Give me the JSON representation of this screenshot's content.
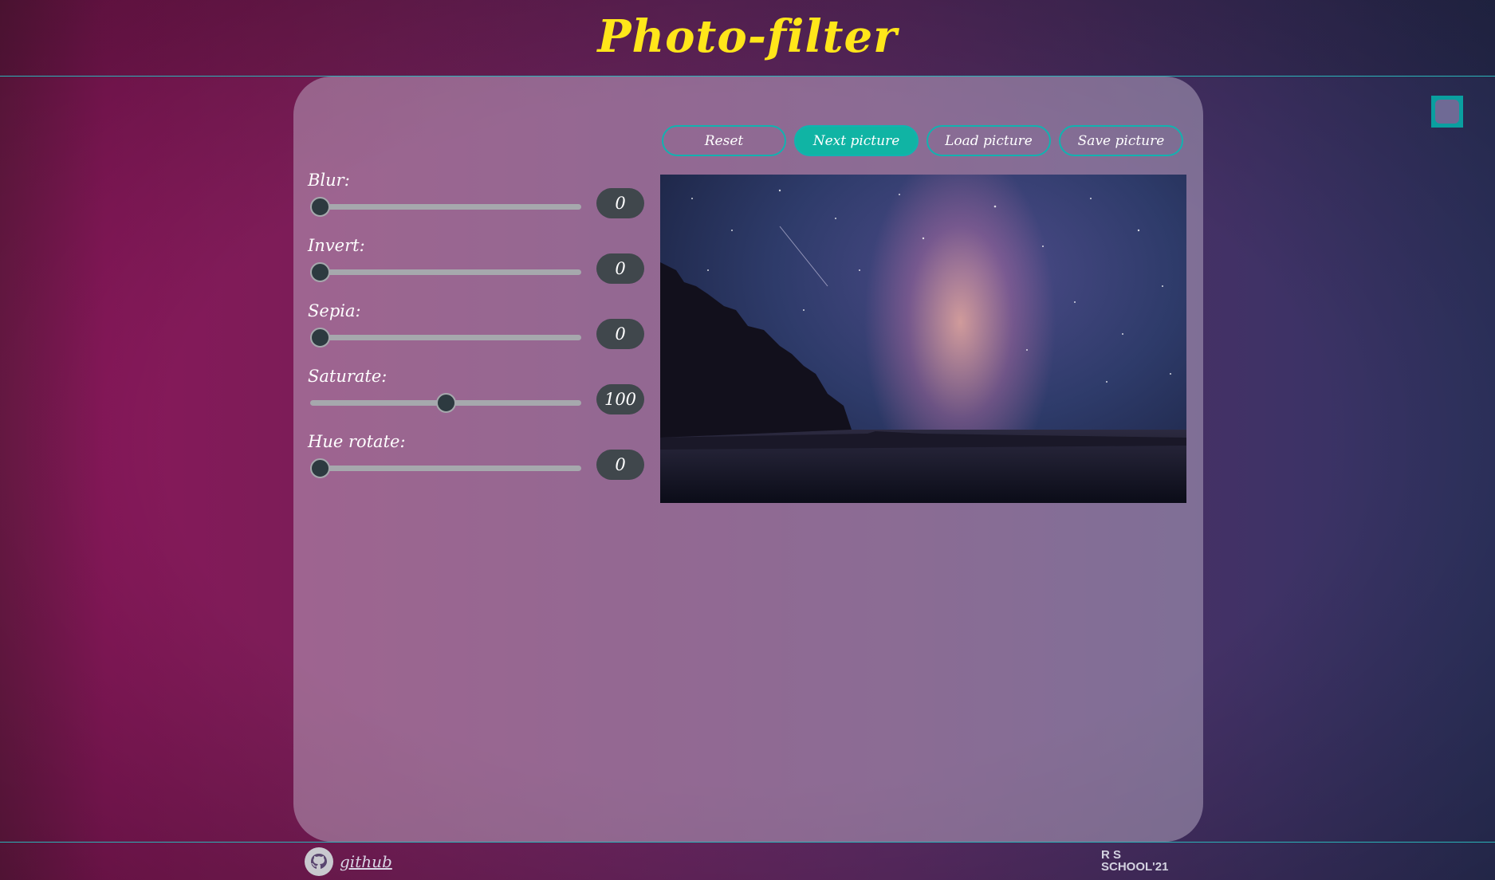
{
  "header": {
    "title": "Photo-filter"
  },
  "toolbar": {
    "buttons": [
      {
        "label": "Reset",
        "active": false
      },
      {
        "label": "Next picture",
        "active": true
      },
      {
        "label": "Load picture",
        "active": false
      },
      {
        "label": "Save picture",
        "active": false
      }
    ]
  },
  "filters": [
    {
      "label": "Blur:",
      "value": "0",
      "fraction": 0.0
    },
    {
      "label": "Invert:",
      "value": "0",
      "fraction": 0.0
    },
    {
      "label": "Sepia:",
      "value": "0",
      "fraction": 0.0
    },
    {
      "label": "Saturate:",
      "value": "100",
      "fraction": 0.5
    },
    {
      "label": "Hue rotate:",
      "value": "0",
      "fraction": 0.0
    }
  ],
  "footer": {
    "github_label": "github",
    "logo_text": {
      "line1": "R  S",
      "line2": "SCHOOL'21"
    }
  },
  "colors": {
    "title": "#ffe61a",
    "accent": "#10b4a4",
    "pill": "#40474c"
  },
  "icons": {
    "fullscreen": "fullscreen-icon",
    "github": "github-icon"
  }
}
